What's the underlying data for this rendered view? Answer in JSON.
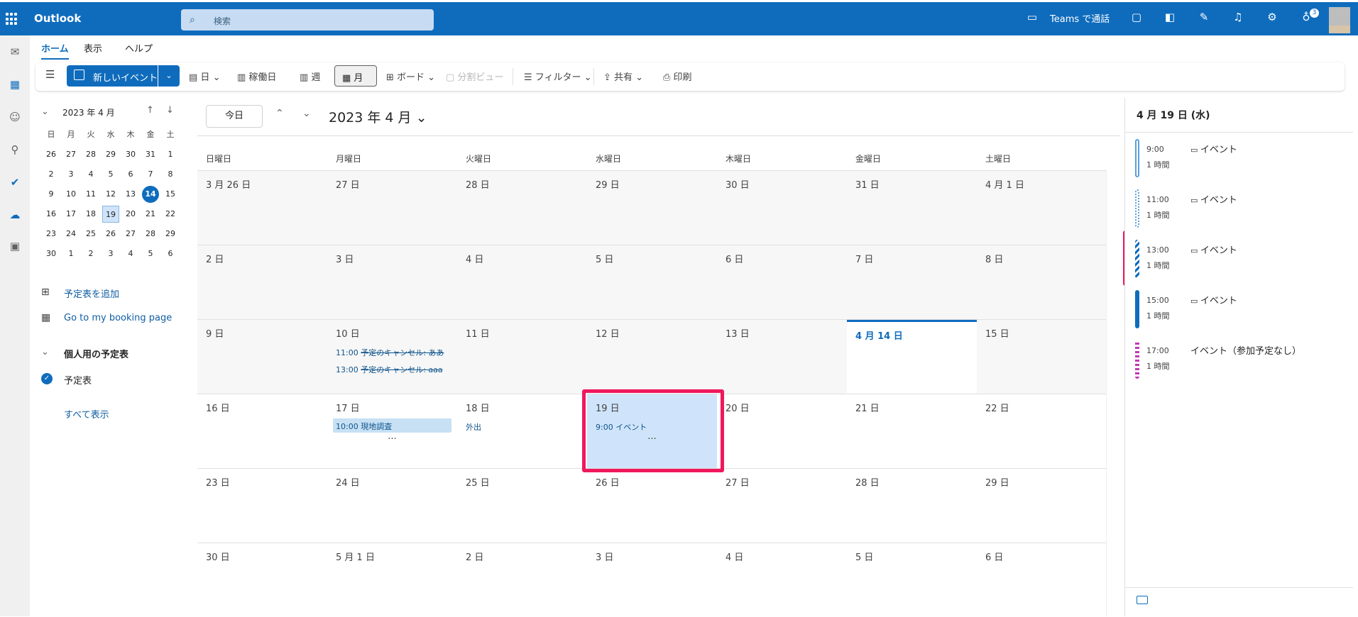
{
  "app": {
    "title": "Outlook",
    "accent": "#0f6cbd",
    "highlight": "#f0185d"
  },
  "search": {
    "placeholder": "検索"
  },
  "topbar": {
    "teams_call": "Teams で通話",
    "notification_count": "3",
    "icons": [
      "teams-video-icon",
      "chat-icon",
      "office-icon",
      "task-icon",
      "bell-icon",
      "gear-icon",
      "lightbulb-icon"
    ]
  },
  "tabs": [
    "ホーム",
    "表示",
    "ヘルプ"
  ],
  "ribbon": {
    "new_event": "新しいイベント",
    "day": "日",
    "workweek": "稼働日",
    "week": "週",
    "month": "月",
    "board": "ボード",
    "split": "分割ビュー",
    "filter": "フィルター",
    "share": "共有",
    "print": "印刷"
  },
  "mini_calendar": {
    "title": "2023 年 4 月",
    "weekdays": [
      "日",
      "月",
      "火",
      "水",
      "木",
      "金",
      "土"
    ],
    "rows": [
      [
        "26",
        "27",
        "28",
        "29",
        "30",
        "31",
        "1"
      ],
      [
        "2",
        "3",
        "4",
        "5",
        "6",
        "7",
        "8"
      ],
      [
        "9",
        "10",
        "11",
        "12",
        "13",
        "14",
        "15"
      ],
      [
        "16",
        "17",
        "18",
        "19",
        "20",
        "21",
        "22"
      ],
      [
        "23",
        "24",
        "25",
        "26",
        "27",
        "28",
        "29"
      ],
      [
        "30",
        "1",
        "2",
        "3",
        "4",
        "5",
        "6"
      ]
    ],
    "today": "14",
    "selected": "19"
  },
  "sidebar": {
    "add_calendar": "予定表を追加",
    "booking": "Go to my booking page",
    "personal_header": "個人用の予定表",
    "calendar_item": "予定表",
    "show_all": "すべて表示"
  },
  "calendar": {
    "today_button": "今日",
    "month_title": "2023 年 4 月",
    "weekdays": [
      "日曜日",
      "月曜日",
      "火曜日",
      "水曜日",
      "木曜日",
      "金曜日",
      "土曜日"
    ],
    "weeks": [
      [
        "3 月 26 日",
        "27 日",
        "28 日",
        "29 日",
        "30 日",
        "31 日",
        "4 月 1 日"
      ],
      [
        "2 日",
        "3 日",
        "4 日",
        "5 日",
        "6 日",
        "7 日",
        "8 日"
      ],
      [
        "9 日",
        "10 日",
        "11 日",
        "12 日",
        "13 日",
        "4 月 14 日",
        "15 日"
      ],
      [
        "16 日",
        "17 日",
        "18 日",
        "19 日",
        "20 日",
        "21 日",
        "22 日"
      ],
      [
        "23 日",
        "24 日",
        "25 日",
        "26 日",
        "27 日",
        "28 日",
        "29 日"
      ],
      [
        "30 日",
        "5 月 1 日",
        "2 日",
        "3 日",
        "4 日",
        "5 日",
        "6 日"
      ]
    ],
    "events": {
      "cancel1_time": "11:00",
      "cancel1_title": "予定のキャンセル: ああ",
      "cancel2_time": "13:00",
      "cancel2_title": "予定のキャンセル: aaa",
      "site_time": "10:00",
      "site_title": "現地調査",
      "out_title": "外出",
      "ev19_time": "9:00",
      "ev19_title": "イベント",
      "more": "···"
    }
  },
  "agenda": {
    "title": "4 月 19 日 (水)",
    "items": [
      {
        "time": "9:00",
        "duration": "1 時間",
        "name": "イベント"
      },
      {
        "time": "11:00",
        "duration": "1 時間",
        "name": "イベント"
      },
      {
        "time": "13:00",
        "duration": "1 時間",
        "name": "イベント"
      },
      {
        "time": "15:00",
        "duration": "1 時間",
        "name": "イベント"
      },
      {
        "time": "17:00",
        "duration": "1 時間",
        "name": "イベント（参加予定なし）"
      }
    ]
  }
}
